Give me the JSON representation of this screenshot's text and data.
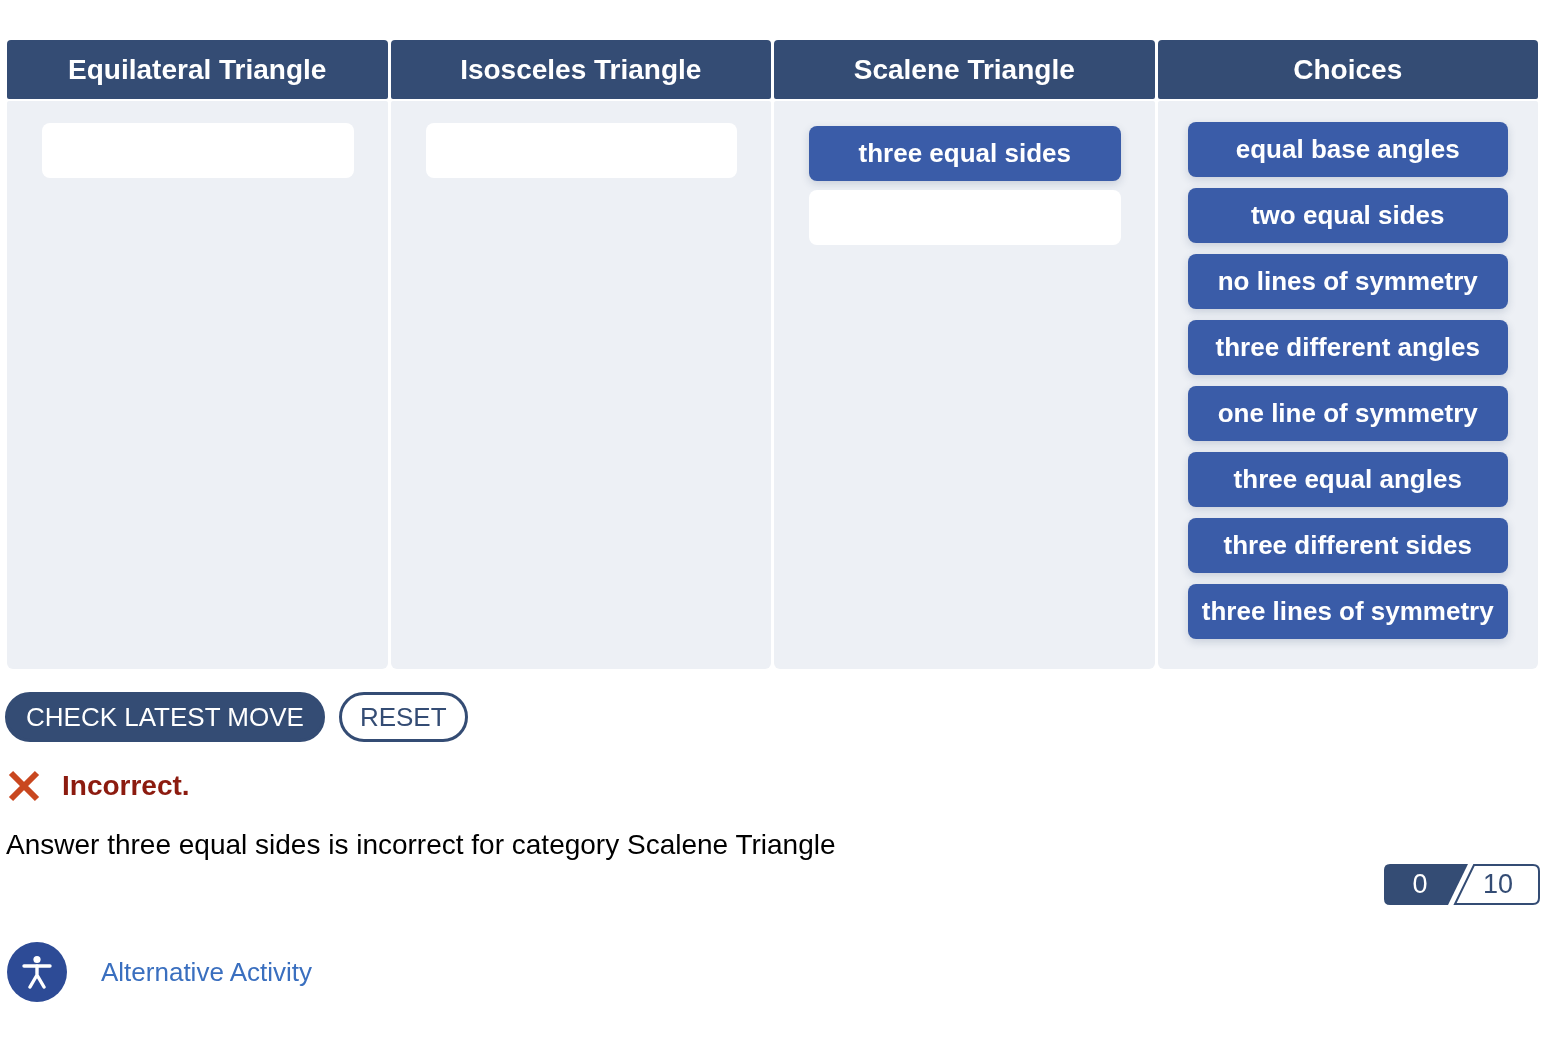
{
  "columns": [
    {
      "kind": "category",
      "heading": "Equilateral Triangle"
    },
    {
      "kind": "category",
      "heading": "Isosceles Triangle"
    },
    {
      "kind": "category",
      "heading": "Scalene Triangle",
      "placed": [
        "three equal sides"
      ]
    },
    {
      "kind": "bank",
      "heading": "Choices",
      "items": [
        "equal base angles",
        "two equal sides",
        "no lines of symmetry",
        "three different angles",
        "one line of symmetry",
        "three equal angles",
        "three different sides",
        "three lines of symmetry"
      ]
    }
  ],
  "buttons": [
    {
      "kind": "primary",
      "label": "CHECK LATEST MOVE"
    },
    {
      "kind": "outline",
      "label": "RESET"
    }
  ],
  "feedback": {
    "correct": false,
    "title": "Incorrect.",
    "message": "Answer three equal sides is incorrect for category Scalene Triangle"
  },
  "score": {
    "value": "0",
    "total": "10"
  },
  "alternative_activity": {
    "label": "Alternative Activity"
  }
}
